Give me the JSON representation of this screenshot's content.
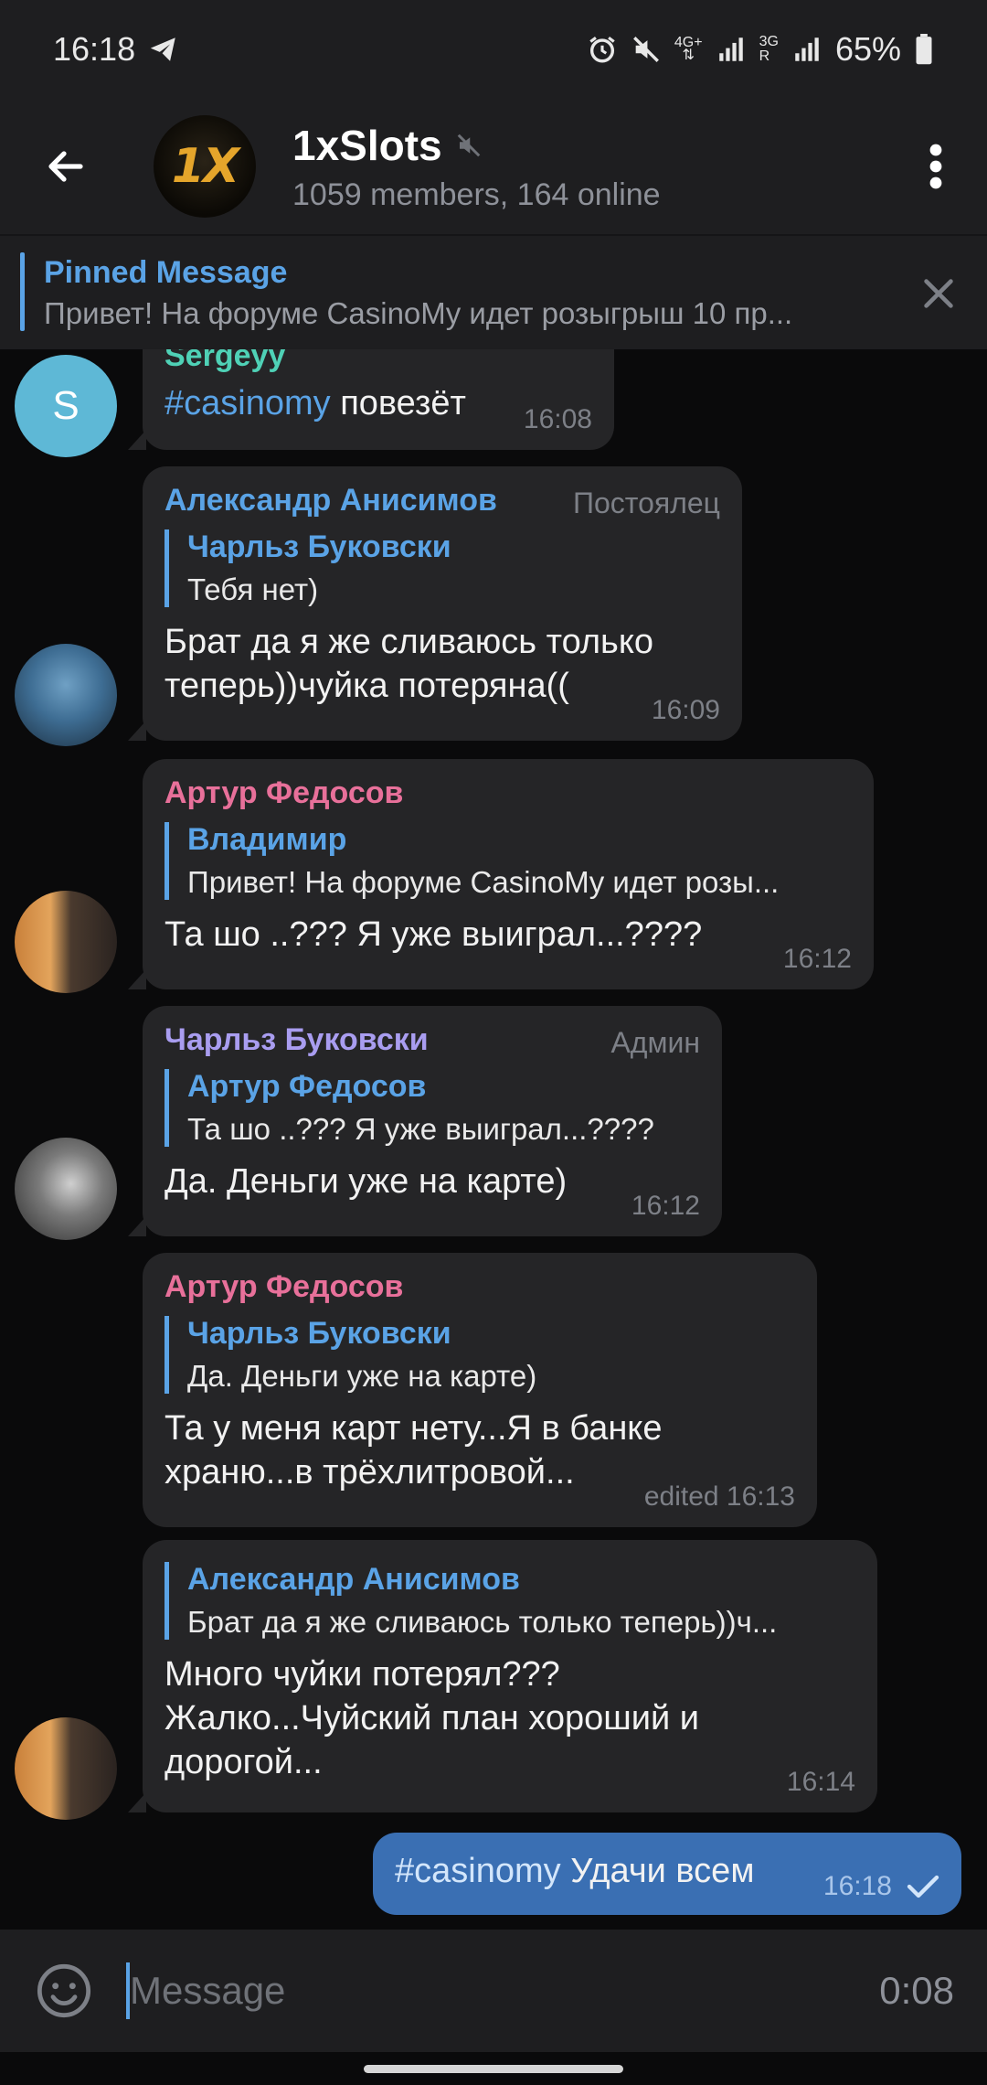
{
  "status_bar": {
    "time": "16:18",
    "network_4g": "4G+",
    "network_3g": "3G",
    "roaming": "R",
    "battery": "65%",
    "icons": [
      "telegram-icon",
      "alarm-icon",
      "mute-icon",
      "signal-icon",
      "signal-icon",
      "battery-icon"
    ]
  },
  "header": {
    "title": "1xSlots",
    "subtitle": "1059 members, 164 online",
    "avatar_text": "1X"
  },
  "pinned": {
    "title": "Pinned Message",
    "text": "Привет! На форуме CasinoMy идет розыгрыш 10 пр..."
  },
  "messages": [
    {
      "sender": "Sergeyy",
      "sender_color": "#4fd1b6",
      "avatar_letter": "S",
      "hashtag": "#casinomy",
      "text": " повезёт",
      "time": "16:08"
    },
    {
      "sender": "Александр Анисимов",
      "sender_color": "#5aa3e6",
      "role": "Постоялец",
      "reply_name": "Чарльз Буковски",
      "reply_text": "Тебя нет)",
      "text": "Брат да я же сливаюсь только теперь))чуйка потеряна((",
      "time": "16:09"
    },
    {
      "sender": "Артур Федосов",
      "sender_color": "#e8709a",
      "reply_name": "Владимир",
      "reply_text": "Привет! На форуме CasinoMy идет розы...",
      "text": "Та шо ..??? Я уже выиграл...????",
      "time": "16:12"
    },
    {
      "sender": "Чарльз Буковски",
      "sender_color": "#a99df0",
      "role": "Админ",
      "reply_name": "Артур Федосов",
      "reply_text": "Та шо ..??? Я уже выиграл...????",
      "text": "Да. Деньги уже на карте)",
      "time": "16:12"
    },
    {
      "sender": "Артур Федосов",
      "sender_color": "#e8709a",
      "reply_name": "Чарльз Буковски",
      "reply_text": "Да. Деньги уже на карте)",
      "text": "Та у меня карт нету...Я в банке храню...в трёхлитровой...",
      "time": "edited 16:13"
    },
    {
      "reply_name": "Александр Анисимов",
      "reply_text": "Брат да я же сливаюсь только теперь))ч...",
      "text": "Много чуйки потерял??? Жалко...Чуйский план хороший и дорогой...",
      "time": "16:14"
    }
  ],
  "outgoing": {
    "hashtag": "#casinomy",
    "text": " Удачи всем",
    "time": "16:18"
  },
  "composer": {
    "placeholder": "Message",
    "record_time": "0:08"
  },
  "colors": {
    "accent": "#5aa3e6",
    "outgoing_bubble": "#3a6fb3",
    "incoming_bubble": "#252527",
    "header_bg": "#1e1e20"
  }
}
